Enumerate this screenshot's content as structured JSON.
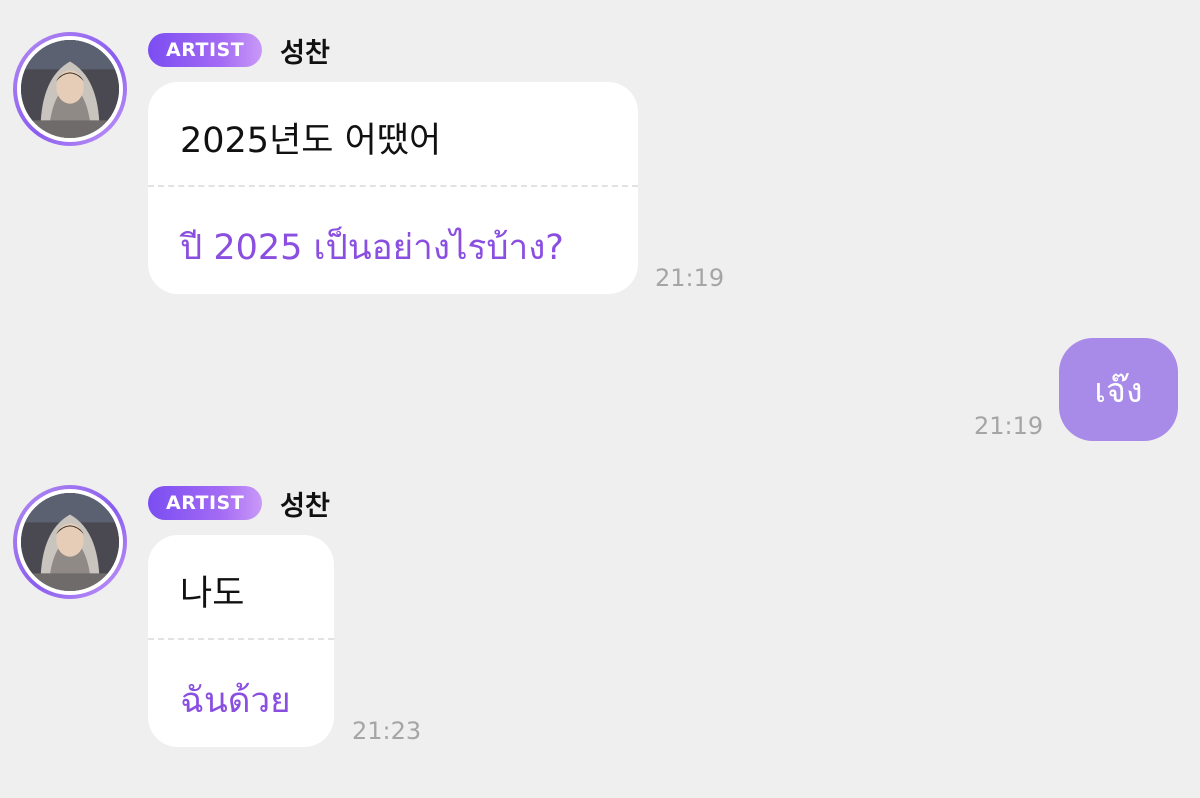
{
  "messages": [
    {
      "sender": {
        "badge": "ARTIST",
        "name": "성찬",
        "avatar_icon": "artist-profile-photo"
      },
      "original": "2025년도 어땠어",
      "translation": "ปี 2025 เป็นอย่างไรบ้าง?",
      "time": "21:19"
    },
    {
      "mine": {
        "text": "เจ๊ง",
        "time": "21:19"
      }
    },
    {
      "sender": {
        "badge": "ARTIST",
        "name": "성찬",
        "avatar_icon": "artist-profile-photo"
      },
      "original": "나도",
      "translation": "ฉันด้วย",
      "time": "21:23"
    }
  ],
  "colors": {
    "background": "#efeff0",
    "bubble": "#ffffff",
    "my_bubble": "#a88ae8",
    "translation_text": "#8a4ee0",
    "badge_gradient_start": "#7b4df2",
    "badge_gradient_end": "#c999f7",
    "timestamp": "#a5a5a8"
  }
}
